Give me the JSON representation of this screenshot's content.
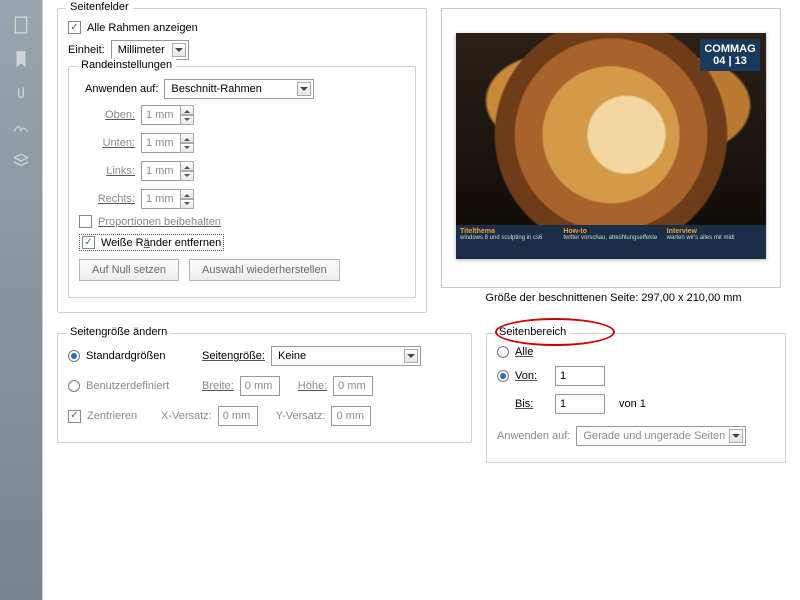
{
  "seitenfelder": {
    "legend": "Seitenfelder",
    "alle_rahmen": "Alle Rahmen anzeigen",
    "einheit_label": "Einheit:",
    "einheit_value": "Millimeter"
  },
  "rand": {
    "legend": "Randeinstellungen",
    "anwenden_label": "Anwenden auf:",
    "anwenden_value": "Beschnitt-Rahmen",
    "oben": "Oben:",
    "unten": "Unten:",
    "links": "Links:",
    "rechts": "Rechts:",
    "mm": "1 mm",
    "prop": "Proportionen beibehalten",
    "weiss": "Weiße Ränder entfernen",
    "null_btn": "Auf Null setzen",
    "wieder_btn": "Auswahl wiederherstellen"
  },
  "preview": {
    "badge1": "COMMAG",
    "badge2": "04 | 13",
    "f1t": "Titelthema",
    "f1s": "windows 8 und sculpting in cs6",
    "f2t": "How-to",
    "f2s": "twitter vorschau, abkühlungseffekte",
    "f3t": "Interview",
    "f3s": "warten wir's alles mit midi",
    "caption": "Größe der beschnittenen Seite: 297,00 x 210,00 mm"
  },
  "sg": {
    "legend": "Seitengröße ändern",
    "std": "Standardgrößen",
    "seitengr": "Seitengröße:",
    "keine": "Keine",
    "benutzer": "Benutzerdefiniert",
    "breite": "Breite:",
    "hoehe": "Höhe:",
    "zero": "0 mm",
    "zentr": "Zentrieren",
    "xv": "X-Versatz:",
    "yv": "Y-Versatz:"
  },
  "sb": {
    "legend": "Seitenbereich",
    "alle": "Alle",
    "von": "Von:",
    "von_val": "1",
    "bis": "Bis:",
    "bis_val": "1",
    "von_n": "von 1",
    "anw": "Anwenden auf:",
    "anw_val": "Gerade und ungerade Seiten"
  }
}
